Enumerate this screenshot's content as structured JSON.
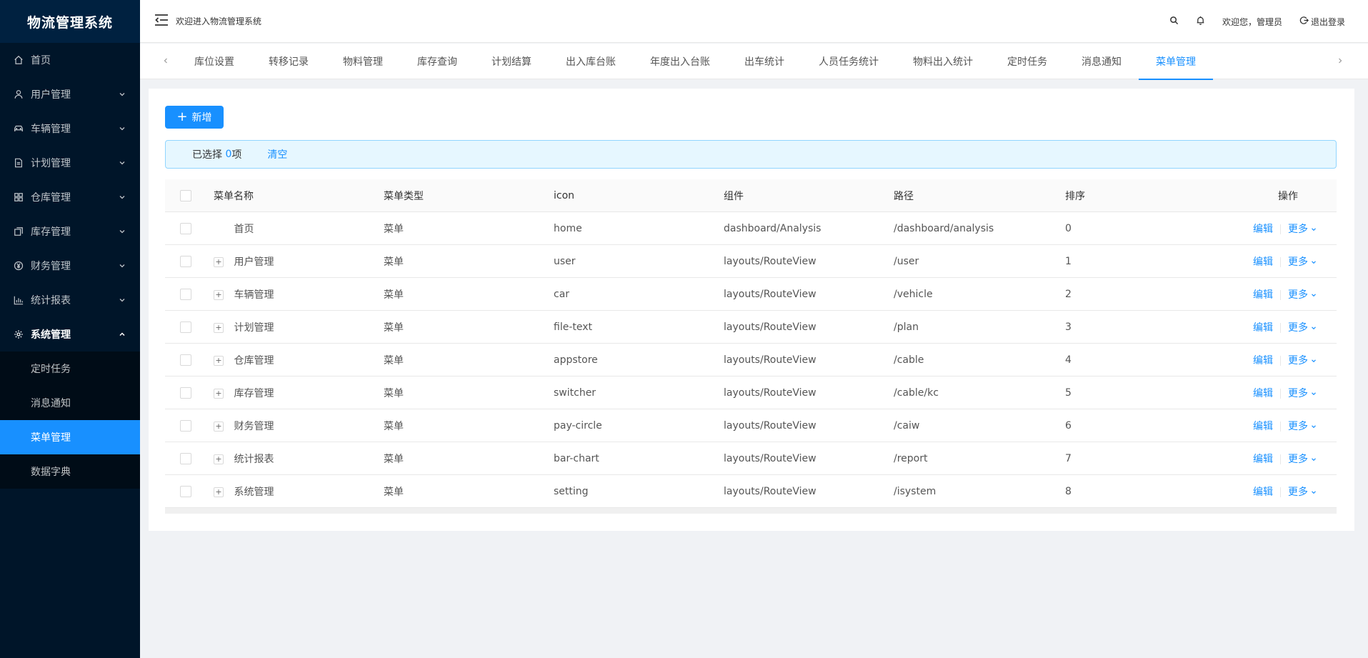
{
  "app": {
    "title": "物流管理系统"
  },
  "sidebar": {
    "items": [
      {
        "label": "首页",
        "icon": "home-icon"
      },
      {
        "label": "用户管理",
        "icon": "user-icon"
      },
      {
        "label": "车辆管理",
        "icon": "car-icon"
      },
      {
        "label": "计划管理",
        "icon": "file-text-icon"
      },
      {
        "label": "仓库管理",
        "icon": "appstore-icon"
      },
      {
        "label": "库存管理",
        "icon": "switcher-icon"
      },
      {
        "label": "财务管理",
        "icon": "pay-circle-icon"
      },
      {
        "label": "统计报表",
        "icon": "bar-chart-icon"
      },
      {
        "label": "系统管理",
        "icon": "setting-icon"
      }
    ],
    "submenu": [
      {
        "label": "定时任务"
      },
      {
        "label": "消息通知"
      },
      {
        "label": "菜单管理"
      },
      {
        "label": "数据字典"
      }
    ]
  },
  "header": {
    "welcome": "欢迎进入物流管理系统",
    "user_greeting": "欢迎您，管理员",
    "logout": "退出登录"
  },
  "tabs": [
    {
      "label": "库位设置"
    },
    {
      "label": "转移记录"
    },
    {
      "label": "物料管理"
    },
    {
      "label": "库存查询"
    },
    {
      "label": "计划结算"
    },
    {
      "label": "出入库台账"
    },
    {
      "label": "年度出入台账"
    },
    {
      "label": "出车统计"
    },
    {
      "label": "人员任务统计"
    },
    {
      "label": "物料出入统计"
    },
    {
      "label": "定时任务"
    },
    {
      "label": "消息通知"
    },
    {
      "label": "菜单管理"
    }
  ],
  "toolbar": {
    "add_label": "新增"
  },
  "selection": {
    "prefix": "已选择 ",
    "count": "0",
    "suffix": "项",
    "clear": "清空"
  },
  "table": {
    "columns": [
      "菜单名称",
      "菜单类型",
      "icon",
      "组件",
      "路径",
      "排序",
      "操作"
    ],
    "edit_label": "编辑",
    "more_label": "更多",
    "rows": [
      {
        "name": "首页",
        "type": "菜单",
        "icon": "home",
        "component": "dashboard/Analysis",
        "path": "/dashboard/analysis",
        "sort": "0",
        "expandable": false
      },
      {
        "name": "用户管理",
        "type": "菜单",
        "icon": "user",
        "component": "layouts/RouteView",
        "path": "/user",
        "sort": "1",
        "expandable": true
      },
      {
        "name": "车辆管理",
        "type": "菜单",
        "icon": "car",
        "component": "layouts/RouteView",
        "path": "/vehicle",
        "sort": "2",
        "expandable": true
      },
      {
        "name": "计划管理",
        "type": "菜单",
        "icon": "file-text",
        "component": "layouts/RouteView",
        "path": "/plan",
        "sort": "3",
        "expandable": true
      },
      {
        "name": "仓库管理",
        "type": "菜单",
        "icon": "appstore",
        "component": "layouts/RouteView",
        "path": "/cable",
        "sort": "4",
        "expandable": true
      },
      {
        "name": "库存管理",
        "type": "菜单",
        "icon": "switcher",
        "component": "layouts/RouteView",
        "path": "/cable/kc",
        "sort": "5",
        "expandable": true
      },
      {
        "name": "财务管理",
        "type": "菜单",
        "icon": "pay-circle",
        "component": "layouts/RouteView",
        "path": "/caiw",
        "sort": "6",
        "expandable": true
      },
      {
        "name": "统计报表",
        "type": "菜单",
        "icon": "bar-chart",
        "component": "layouts/RouteView",
        "path": "/report",
        "sort": "7",
        "expandable": true
      },
      {
        "name": "系统管理",
        "type": "菜单",
        "icon": "setting",
        "component": "layouts/RouteView",
        "path": "/isystem",
        "sort": "8",
        "expandable": true
      }
    ]
  },
  "colors": {
    "primary": "#1890ff",
    "sidebar_bg": "#001529",
    "logo_bg": "#002140"
  }
}
